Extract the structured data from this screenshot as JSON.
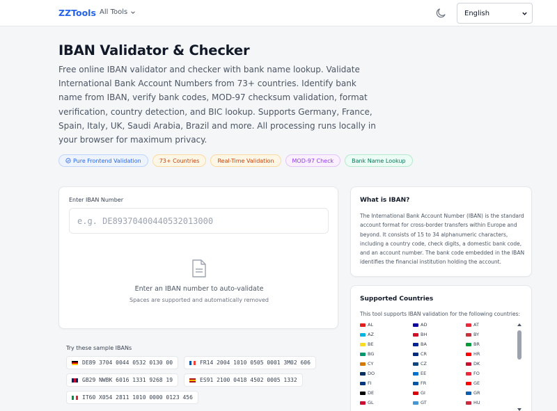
{
  "header": {
    "logo": "ZZTools",
    "all_tools": "All Tools",
    "language": "English"
  },
  "hero": {
    "title": "IBAN Validator & Checker",
    "description": "Free online IBAN validator and checker with bank name lookup. Validate International Bank Account Numbers from 73+ countries. Identify bank name from IBAN, verify bank codes, MOD-97 checksum validation, format verification, country detection, and BIC lookup. Supports Germany, France, Spain, Italy, UK, Saudi Arabia, Brazil and more. All processing runs locally in your browser for maximum privacy.",
    "badges": [
      {
        "label": "Pure Frontend Validation",
        "bg": "#eef4ff",
        "border": "#bfd4fb",
        "color": "#2563eb"
      },
      {
        "label": "73+ Countries",
        "bg": "#fff7e6",
        "border": "#fbd9a0",
        "color": "#c2410c"
      },
      {
        "label": "Real-Time Validation",
        "bg": "#fff7e6",
        "border": "#fbd9a0",
        "color": "#c2410c"
      },
      {
        "label": "MOD-97 Check",
        "bg": "#faf0ff",
        "border": "#e4c4f7",
        "color": "#9333ea"
      },
      {
        "label": "Bank Name Lookup",
        "bg": "#ecfdf5",
        "border": "#b5e9cf",
        "color": "#047857"
      }
    ]
  },
  "input": {
    "label": "Enter IBAN Number",
    "placeholder": "e.g. DE89370400440532013000",
    "empty_title": "Enter an IBAN number to auto-validate",
    "empty_subtitle": "Spaces are supported and automatically removed"
  },
  "samples": {
    "title": "Try these sample IBANs",
    "items": [
      {
        "country": "DE",
        "iban": "DE89 3704 0044 0532 0130 00"
      },
      {
        "country": "FR",
        "iban": "FR14 2004 1010 0505 0001 3M02 606"
      },
      {
        "country": "GB",
        "iban": "GB29 NWBK 6016 1331 9268 19"
      },
      {
        "country": "ES",
        "iban": "ES91 2100 0418 4502 0005 1332"
      },
      {
        "country": "IT",
        "iban": "IT60 X054 2811 1010 0000 0123 456"
      }
    ]
  },
  "about": {
    "title": "What is IBAN?",
    "text": "The International Bank Account Number (IBAN) is the standard account format for cross-border transfers within Europe and beyond. It consists of 15 to 34 alphanumeric characters, including a country code, check digits, a domestic bank code, and an account number. The bank code embedded in the IBAN identifies the financial institution holding the account."
  },
  "countries": {
    "title": "Supported Countries",
    "subtitle": "This tool supports IBAN validation for the following countries:",
    "items": [
      {
        "code": "AL",
        "color": "#e41e20"
      },
      {
        "code": "AD",
        "color": "#10069f"
      },
      {
        "code": "AT",
        "color": "#ed2939"
      },
      {
        "code": "AZ",
        "color": "#00b5e2"
      },
      {
        "code": "BH",
        "color": "#ce1126"
      },
      {
        "code": "BY",
        "color": "#c8313e"
      },
      {
        "code": "BE",
        "color": "#fdda24"
      },
      {
        "code": "BA",
        "color": "#002395"
      },
      {
        "code": "BR",
        "color": "#009c3b"
      },
      {
        "code": "BG",
        "color": "#00966e"
      },
      {
        "code": "CR",
        "color": "#002b7f"
      },
      {
        "code": "HR",
        "color": "#ff0000"
      },
      {
        "code": "CY",
        "color": "#d57800"
      },
      {
        "code": "CZ",
        "color": "#11457e"
      },
      {
        "code": "DK",
        "color": "#c8102e"
      },
      {
        "code": "DO",
        "color": "#002d62"
      },
      {
        "code": "EE",
        "color": "#0072ce"
      },
      {
        "code": "FO",
        "color": "#ed2939"
      },
      {
        "code": "FI",
        "color": "#003580"
      },
      {
        "code": "FR",
        "color": "#0055a4"
      },
      {
        "code": "GE",
        "color": "#ff0000"
      },
      {
        "code": "DE",
        "color": "#000000"
      },
      {
        "code": "GI",
        "color": "#da000c"
      },
      {
        "code": "GR",
        "color": "#0d5eaf"
      },
      {
        "code": "GL",
        "color": "#d00c33"
      },
      {
        "code": "GT",
        "color": "#4997d0"
      },
      {
        "code": "HU",
        "color": "#cd2a3e"
      }
    ]
  }
}
